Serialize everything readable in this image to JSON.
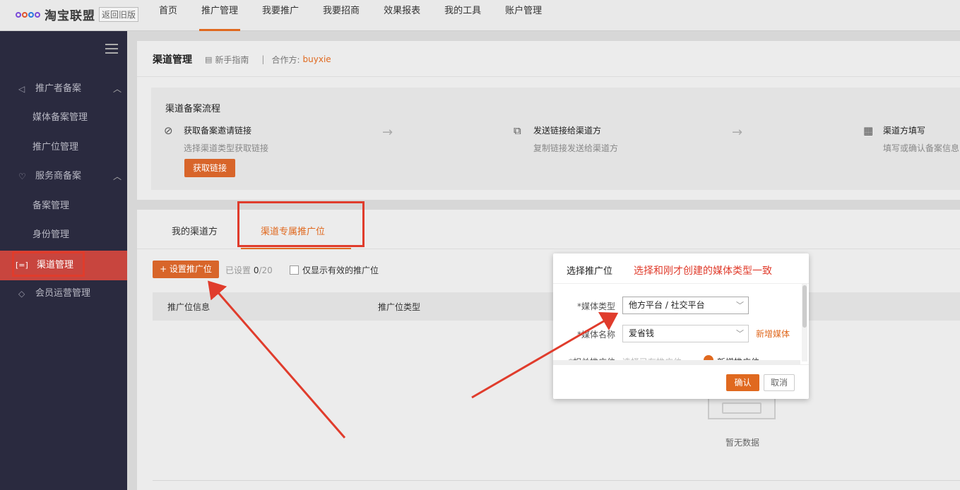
{
  "header": {
    "logo_text": "淘宝联盟",
    "old_version": "返回旧版",
    "nav": [
      "首页",
      "推广管理",
      "我要推广",
      "我要招商",
      "效果报表",
      "我的工具",
      "账户管理"
    ],
    "active_nav": "推广管理",
    "accent_color": "#e0691f"
  },
  "sidebar": {
    "groups": [
      {
        "label": "推广者备案",
        "icon": "megaphone-icon",
        "items": [
          "媒体备案管理",
          "推广位管理"
        ]
      },
      {
        "label": "服务商备案",
        "icon": "heart-hand-icon",
        "items": [
          "备案管理",
          "身份管理"
        ]
      }
    ],
    "active_item": "渠道管理",
    "extra_group": "会员运营管理"
  },
  "breadcrumb": {
    "title": "渠道管理",
    "guide": "新手指南",
    "partner_label": "合作方:",
    "partner_name": "buyxie"
  },
  "flow": {
    "title": "渠道备案流程",
    "steps": [
      {
        "title": "获取备案邀请链接",
        "desc": "选择渠道类型获取链接",
        "icon": "link-icon"
      },
      {
        "title": "发送链接给渠道方",
        "desc": "复制链接发送给渠道方",
        "icon": "share-icon"
      },
      {
        "title": "渠道方填写",
        "desc": "填写或确认备案信息",
        "icon": "form-icon"
      }
    ],
    "get_link_button": "获取链接"
  },
  "tabs": [
    "我的渠道方",
    "渠道专属推广位"
  ],
  "active_tab": "渠道专属推广位",
  "toolbar": {
    "add_button": "+ 设置推广位",
    "set_label": "已设置",
    "set_count": "0",
    "set_total": "/20",
    "valid_only": "仅显示有效的推广位"
  },
  "table": {
    "headers": [
      "推广位信息",
      "推广位类型"
    ],
    "empty_text": "暂无数据"
  },
  "modal": {
    "title": "选择推广位",
    "annotation_note": "选择和刚才创建的媒体类型一致",
    "media_type_label": "*媒体类型",
    "media_type_value": "他方平台 / 社交平台",
    "media_name_label": "*媒体名称",
    "media_name_value": "爱省钱",
    "new_media": "新增媒体",
    "placement_label": "*相关推广位",
    "placement_option_existing": "选择已有推广位",
    "placement_option_new": "新增推广位",
    "confirm": "确认",
    "cancel": "取消"
  }
}
